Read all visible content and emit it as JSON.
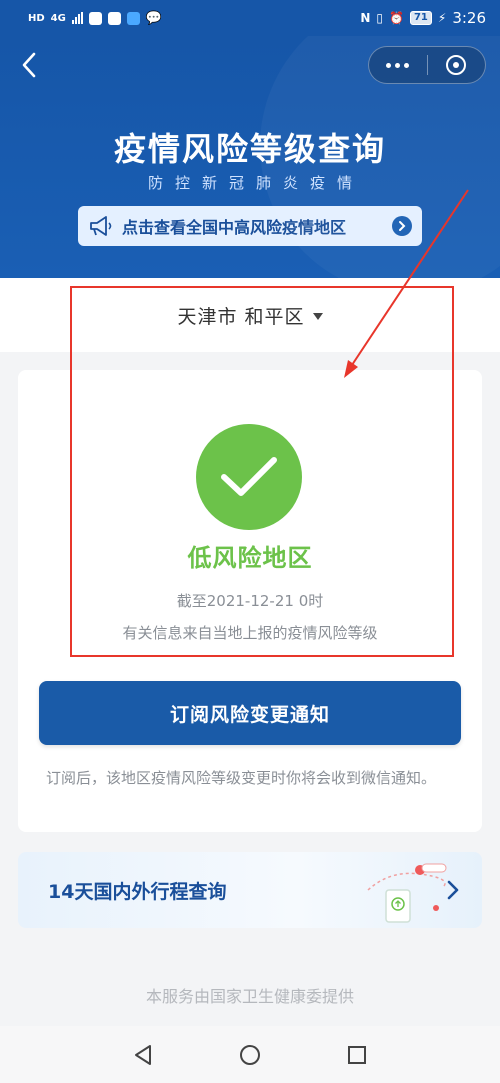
{
  "status_bar": {
    "left_label": "HD",
    "network": "4G",
    "battery": "71",
    "time": "3:26",
    "icons": [
      "hd-icon",
      "signal-icon",
      "app-notification-icon",
      "qq-icon",
      "cloud-icon",
      "chat-icon",
      "nfc-icon",
      "vibrate-icon",
      "alarm-icon",
      "battery-icon",
      "charging-icon"
    ]
  },
  "header": {
    "title": "疫情风险等级查询",
    "subtitle": "防控新冠肺炎疫情",
    "notice_text": "点击查看全国中高风险疫情地区",
    "back_icon": "chevron-left-icon",
    "more_icon": "more-dots-icon",
    "close_icon": "target-circle-icon",
    "colors": {
      "primary": "#1656a8",
      "notice_bg": "#e4f0ff"
    }
  },
  "region": {
    "selected": "天津市 和平区"
  },
  "result": {
    "risk_level": "低风险地区",
    "as_of": "截至2021-12-21 0时",
    "source_note": "有关信息来自当地上报的疫情风险等级",
    "icon": "check-icon",
    "color": "#6cc24a"
  },
  "subscribe": {
    "button_label": "订阅风险变更通知",
    "description": "订阅后，该地区疫情风险等级变更时你将会收到微信通知。"
  },
  "itinerary": {
    "label": "14天国内外行程查询",
    "icon": "chevron-right-icon"
  },
  "footer": {
    "note": "本服务由国家卫生健康委提供"
  },
  "nav": {
    "icons": [
      "back-triangle-icon",
      "home-circle-icon",
      "recents-square-icon"
    ]
  },
  "annotation": {
    "color": "#e8362b"
  }
}
